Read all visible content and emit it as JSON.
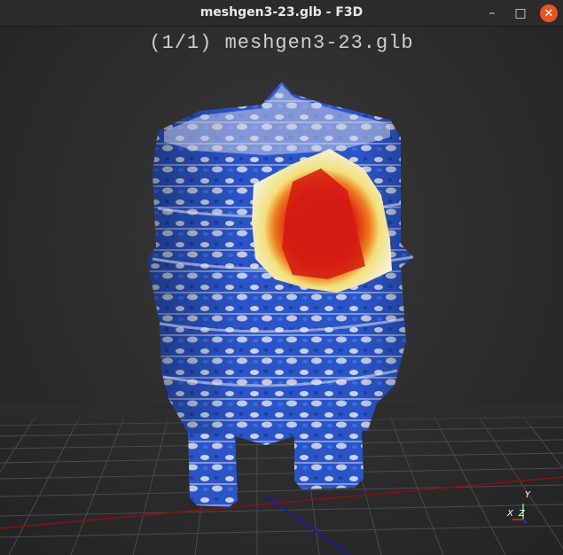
{
  "window": {
    "title": "meshgen3-23.glb - F3D",
    "minimize_icon": "minimize-icon",
    "maximize_icon": "maximize-icon",
    "close_icon": "close-icon"
  },
  "viewport": {
    "filename_overlay": "(1/1) meshgen3-23.glb"
  },
  "axes_gizmo": {
    "y_label": "Y",
    "x_label": "X",
    "z_label": "Z"
  },
  "colors": {
    "model_blue": "#2a55c8",
    "model_white": "#e6e6ee",
    "heat_red": "#d21a12",
    "heat_yellow": "#f2e07a",
    "x_axis": "#8b1010",
    "z_axis": "#1a1aa8"
  }
}
